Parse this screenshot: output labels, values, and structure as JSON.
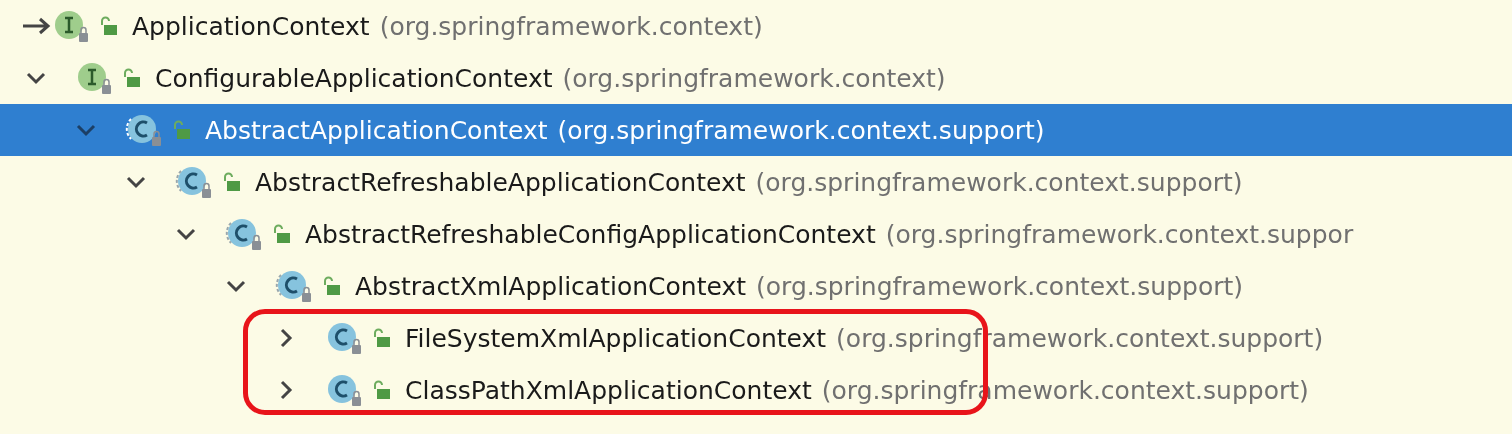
{
  "hierarchy": {
    "root": {
      "name": "ApplicationContext",
      "package": "(org.springframework.context)",
      "kind": "interface",
      "base_marker": true,
      "selected": false,
      "children": [
        {
          "name": "ConfigurableApplicationContext",
          "package": "(org.springframework.context)",
          "kind": "interface",
          "expanded": true,
          "selected": false,
          "children": [
            {
              "name": "AbstractApplicationContext",
              "package": "(org.springframework.context.support)",
              "kind": "abstract_class",
              "expanded": true,
              "selected": true,
              "children": [
                {
                  "name": "AbstractRefreshableApplicationContext",
                  "package": "(org.springframework.context.support)",
                  "kind": "abstract_class",
                  "expanded": true,
                  "selected": false,
                  "children": [
                    {
                      "name": "AbstractRefreshableConfigApplicationContext",
                      "package": "(org.springframework.context.suppor",
                      "kind": "abstract_class",
                      "expanded": true,
                      "selected": false,
                      "children": [
                        {
                          "name": "AbstractXmlApplicationContext",
                          "package": "(org.springframework.context.support)",
                          "kind": "abstract_class",
                          "expanded": true,
                          "selected": false,
                          "circled_children": true,
                          "children": [
                            {
                              "name": "FileSystemXmlApplicationContext",
                              "package": "(org.springframework.context.support)",
                              "kind": "class",
                              "expanded": false,
                              "selected": false
                            },
                            {
                              "name": "ClassPathXmlApplicationContext",
                              "package": "(org.springframework.context.support)",
                              "kind": "class",
                              "expanded": false,
                              "selected": false
                            }
                          ]
                        }
                      ]
                    }
                  ]
                }
              ]
            }
          ]
        }
      ]
    }
  }
}
